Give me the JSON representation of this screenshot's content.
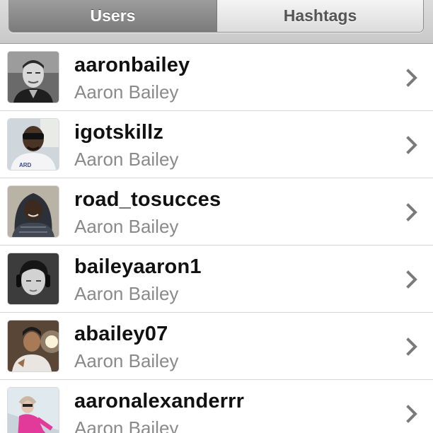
{
  "tabs": {
    "users_label": "Users",
    "hashtags_label": "Hashtags"
  },
  "results": [
    {
      "username": "aaronbailey",
      "full_name": "Aaron Bailey",
      "avatar_icon": "user-photo"
    },
    {
      "username": "igotskillz",
      "full_name": "Aaron Bailey",
      "avatar_icon": "user-photo"
    },
    {
      "username": "road_tosucces",
      "full_name": "Aaron Bailey",
      "avatar_icon": "user-photo"
    },
    {
      "username": "baileyaaron1",
      "full_name": "Aaron Bailey",
      "avatar_icon": "user-photo"
    },
    {
      "username": "abailey07",
      "full_name": "Aaron Bailey",
      "avatar_icon": "user-photo"
    },
    {
      "username": "aaronalexanderrr",
      "full_name": "Aaron Bailey",
      "avatar_icon": "user-photo"
    }
  ],
  "colors": {
    "active_tab": "#888888",
    "username_text": "#111111",
    "fullname_text": "#8a8a8a",
    "chevron": "#7a7a7a"
  }
}
